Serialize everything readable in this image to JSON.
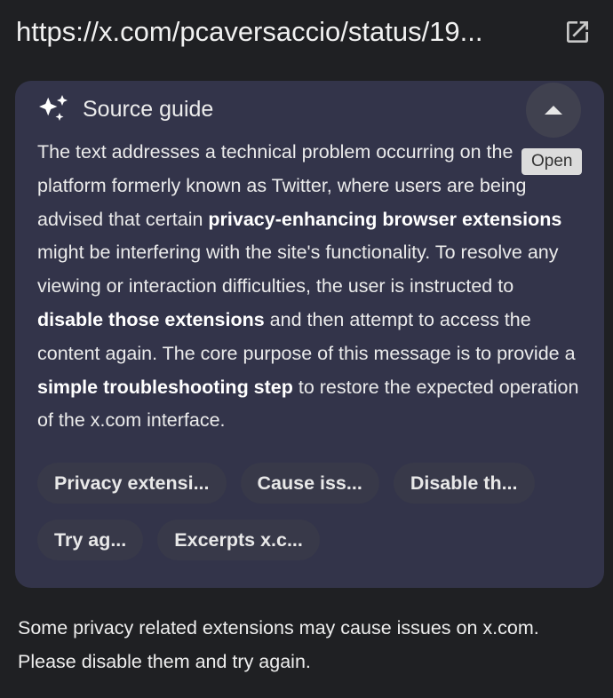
{
  "url_bar": {
    "url": "https://x.com/pcaversaccio/status/19...",
    "open_icon": "open-in-new-icon"
  },
  "card": {
    "icon": "sparkle-icon",
    "title": "Source guide",
    "collapse_icon": "chevron-up-icon",
    "tooltip": "Open",
    "summary": [
      {
        "text": "The text addresses a technical problem occurring on the platform formerly known as Twitter, where users are being advised that certain ",
        "bold": false
      },
      {
        "text": "privacy-enhancing browser extensions",
        "bold": true
      },
      {
        "text": " might be interfering with the site's functionality. To resolve any viewing or interaction difficulties, the user is instructed to ",
        "bold": false
      },
      {
        "text": "disable those extensions",
        "bold": true
      },
      {
        "text": " and then attempt to access the content again. The core purpose of this message is to provide a ",
        "bold": false
      },
      {
        "text": "simple troubleshooting step",
        "bold": true
      },
      {
        "text": " to restore the expected operation of the x.com interface.",
        "bold": false
      }
    ],
    "chips_row1": [
      "Privacy extensi...",
      "Cause iss...",
      "Disable th..."
    ],
    "chips_row2": [
      "Try ag...",
      "Excerpts x.c..."
    ]
  },
  "footer": {
    "text": "Some privacy related extensions may cause issues on x.com. Please disable them and try again."
  },
  "colors": {
    "background": "#1f2023",
    "card": "#33344a",
    "chip": "#383949"
  }
}
